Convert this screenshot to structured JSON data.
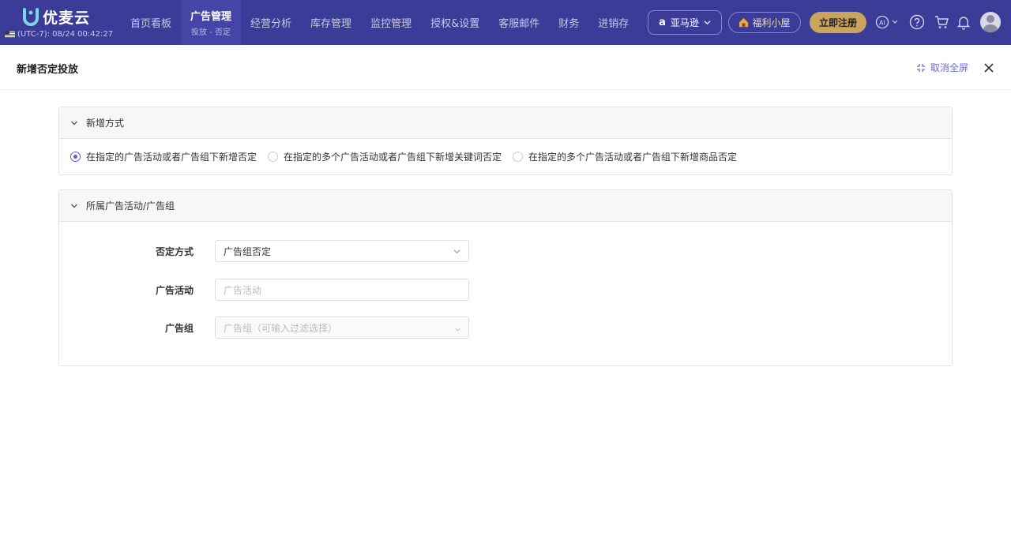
{
  "brand": {
    "name": "优麦云",
    "timezone": "(UTC-7): 08/24 00:42:27"
  },
  "nav": [
    {
      "label": "首页看板",
      "sub": ""
    },
    {
      "label": "广告管理",
      "sub": "投放 - 否定"
    },
    {
      "label": "经营分析",
      "sub": ""
    },
    {
      "label": "库存管理",
      "sub": ""
    },
    {
      "label": "监控管理",
      "sub": ""
    },
    {
      "label": "授权&设置",
      "sub": ""
    },
    {
      "label": "客服邮件",
      "sub": ""
    },
    {
      "label": "财务",
      "sub": ""
    },
    {
      "label": "进销存",
      "sub": ""
    }
  ],
  "topbar": {
    "marketplace": "亚马逊",
    "welfare": "福利小屋",
    "register": "立即注册"
  },
  "drawer": {
    "title": "新增否定投放",
    "exit_fullscreen": "取消全屏"
  },
  "section_method": {
    "title": "新增方式",
    "options": [
      {
        "label": "在指定的广告活动或者广告组下新增否定",
        "checked": true
      },
      {
        "label": "在指定的多个广告活动或者广告组下新增关键词否定",
        "checked": false
      },
      {
        "label": "在指定的多个广告活动或者广告组下新增商品否定",
        "checked": false
      }
    ]
  },
  "section_target": {
    "title": "所属广告活动/广告组",
    "negate_label": "否定方式",
    "negate_value": "广告组否定",
    "campaign_label": "广告活动",
    "campaign_placeholder": "广告活动",
    "adgroup_label": "广告组",
    "adgroup_placeholder": "广告组（可输入过滤选择）"
  },
  "colors": {
    "topbar": "#3b3b98",
    "accent": "#5b5bd6",
    "gold": "#c9a45c"
  }
}
